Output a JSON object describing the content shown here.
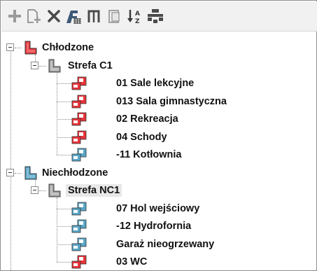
{
  "toolbar": {
    "buttons": [
      {
        "icon": "add-icon"
      },
      {
        "icon": "new-document-icon"
      },
      {
        "icon": "delete-icon"
      },
      {
        "icon": "zone-grid-icon"
      },
      {
        "icon": "split-icon"
      },
      {
        "icon": "copy-icon"
      },
      {
        "icon": "sort-icon"
      },
      {
        "icon": "hierarchy-icon"
      }
    ]
  },
  "tree": {
    "groups": [
      {
        "label": "Chłodzone",
        "color": "#e8343a",
        "zones": [
          {
            "label": "Strefa C1",
            "rooms": [
              {
                "label": "01 Sale lekcyjne",
                "type": "red"
              },
              {
                "label": "013 Sala gimnastyczna",
                "type": "red"
              },
              {
                "label": "02 Rekreacja",
                "type": "red"
              },
              {
                "label": "04 Schody",
                "type": "red"
              },
              {
                "label": "-11 Kotłownia",
                "type": "blue"
              }
            ]
          }
        ]
      },
      {
        "label": "Niechłodzone",
        "color": "#5aa6c8",
        "zones": [
          {
            "label": "Strefa NC1",
            "selected": true,
            "rooms": [
              {
                "label": "07 Hol wejściowy",
                "type": "blue"
              },
              {
                "label": "-12 Hydrofornia",
                "type": "blue"
              },
              {
                "label": " Garaż nieogrzewany",
                "type": "blue"
              },
              {
                "label": "03 WC",
                "type": "red"
              }
            ]
          }
        ]
      }
    ]
  }
}
